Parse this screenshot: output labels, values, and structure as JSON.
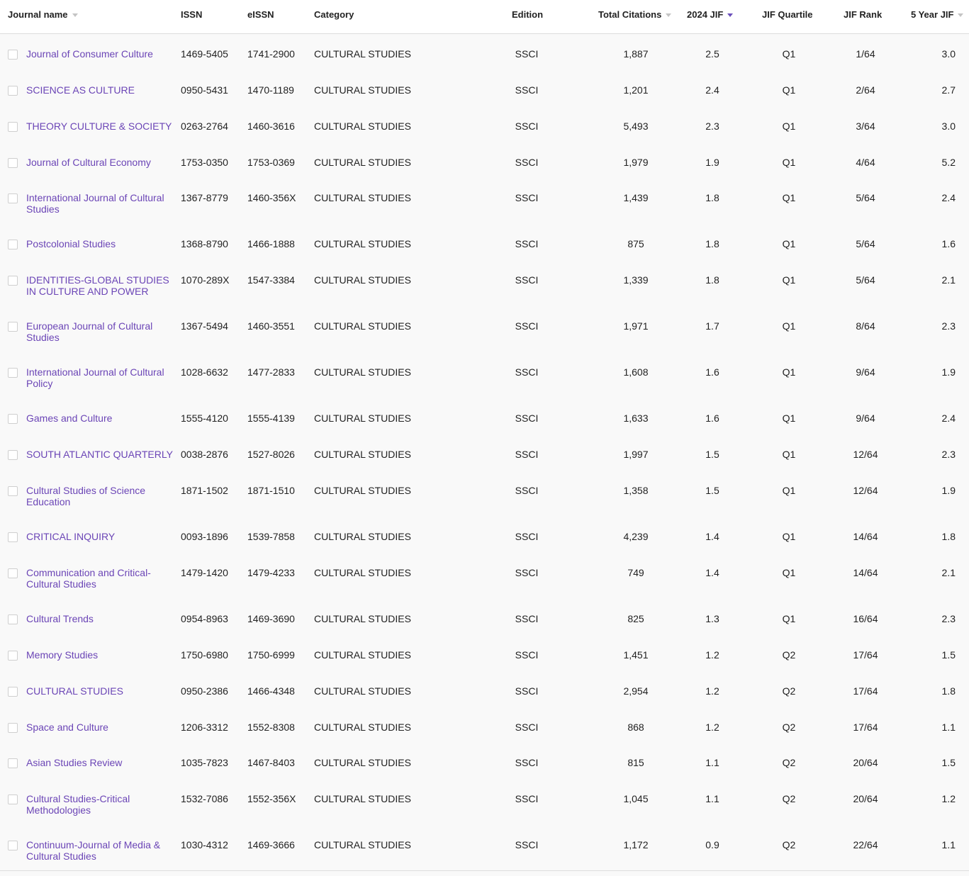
{
  "columns": {
    "journal_name": "Journal name",
    "issn": "ISSN",
    "eissn": "eISSN",
    "category": "Category",
    "edition": "Edition",
    "total_citations": "Total Citations",
    "jif": "2024 JIF",
    "quartile": "JIF Quartile",
    "rank": "JIF Rank",
    "five_year_jif": "5 Year JIF"
  },
  "rows": [
    {
      "name": "Journal of Consumer Culture",
      "issn": "1469-5405",
      "eissn": "1741-2900",
      "category": "CULTURAL STUDIES",
      "edition": "SSCI",
      "citations": "1,887",
      "jif": "2.5",
      "quartile": "Q1",
      "rank": "1/64",
      "five": "3.0"
    },
    {
      "name": "SCIENCE AS CULTURE",
      "issn": "0950-5431",
      "eissn": "1470-1189",
      "category": "CULTURAL STUDIES",
      "edition": "SSCI",
      "citations": "1,201",
      "jif": "2.4",
      "quartile": "Q1",
      "rank": "2/64",
      "five": "2.7"
    },
    {
      "name": "THEORY CULTURE & SOCIETY",
      "issn": "0263-2764",
      "eissn": "1460-3616",
      "category": "CULTURAL STUDIES",
      "edition": "SSCI",
      "citations": "5,493",
      "jif": "2.3",
      "quartile": "Q1",
      "rank": "3/64",
      "five": "3.0"
    },
    {
      "name": "Journal of Cultural Economy",
      "issn": "1753-0350",
      "eissn": "1753-0369",
      "category": "CULTURAL STUDIES",
      "edition": "SSCI",
      "citations": "1,979",
      "jif": "1.9",
      "quartile": "Q1",
      "rank": "4/64",
      "five": "5.2"
    },
    {
      "name": "International Journal of Cultural Studies",
      "issn": "1367-8779",
      "eissn": "1460-356X",
      "category": "CULTURAL STUDIES",
      "edition": "SSCI",
      "citations": "1,439",
      "jif": "1.8",
      "quartile": "Q1",
      "rank": "5/64",
      "five": "2.4"
    },
    {
      "name": "Postcolonial Studies",
      "issn": "1368-8790",
      "eissn": "1466-1888",
      "category": "CULTURAL STUDIES",
      "edition": "SSCI",
      "citations": "875",
      "jif": "1.8",
      "quartile": "Q1",
      "rank": "5/64",
      "five": "1.6"
    },
    {
      "name": "IDENTITIES-GLOBAL STUDIES IN CULTURE AND POWER",
      "issn": "1070-289X",
      "eissn": "1547-3384",
      "category": "CULTURAL STUDIES",
      "edition": "SSCI",
      "citations": "1,339",
      "jif": "1.8",
      "quartile": "Q1",
      "rank": "5/64",
      "five": "2.1"
    },
    {
      "name": "European Journal of Cultural Studies",
      "issn": "1367-5494",
      "eissn": "1460-3551",
      "category": "CULTURAL STUDIES",
      "edition": "SSCI",
      "citations": "1,971",
      "jif": "1.7",
      "quartile": "Q1",
      "rank": "8/64",
      "five": "2.3"
    },
    {
      "name": "International Journal of Cultural Policy",
      "issn": "1028-6632",
      "eissn": "1477-2833",
      "category": "CULTURAL STUDIES",
      "edition": "SSCI",
      "citations": "1,608",
      "jif": "1.6",
      "quartile": "Q1",
      "rank": "9/64",
      "five": "1.9"
    },
    {
      "name": "Games and Culture",
      "issn": "1555-4120",
      "eissn": "1555-4139",
      "category": "CULTURAL STUDIES",
      "edition": "SSCI",
      "citations": "1,633",
      "jif": "1.6",
      "quartile": "Q1",
      "rank": "9/64",
      "five": "2.4"
    },
    {
      "name": "SOUTH ATLANTIC QUARTERLY",
      "issn": "0038-2876",
      "eissn": "1527-8026",
      "category": "CULTURAL STUDIES",
      "edition": "SSCI",
      "citations": "1,997",
      "jif": "1.5",
      "quartile": "Q1",
      "rank": "12/64",
      "five": "2.3"
    },
    {
      "name": "Cultural Studies of Science Education",
      "issn": "1871-1502",
      "eissn": "1871-1510",
      "category": "CULTURAL STUDIES",
      "edition": "SSCI",
      "citations": "1,358",
      "jif": "1.5",
      "quartile": "Q1",
      "rank": "12/64",
      "five": "1.9"
    },
    {
      "name": "CRITICAL INQUIRY",
      "issn": "0093-1896",
      "eissn": "1539-7858",
      "category": "CULTURAL STUDIES",
      "edition": "SSCI",
      "citations": "4,239",
      "jif": "1.4",
      "quartile": "Q1",
      "rank": "14/64",
      "five": "1.8"
    },
    {
      "name": "Communication and Critical-Cultural Studies",
      "issn": "1479-1420",
      "eissn": "1479-4233",
      "category": "CULTURAL STUDIES",
      "edition": "SSCI",
      "citations": "749",
      "jif": "1.4",
      "quartile": "Q1",
      "rank": "14/64",
      "five": "2.1"
    },
    {
      "name": "Cultural Trends",
      "issn": "0954-8963",
      "eissn": "1469-3690",
      "category": "CULTURAL STUDIES",
      "edition": "SSCI",
      "citations": "825",
      "jif": "1.3",
      "quartile": "Q1",
      "rank": "16/64",
      "five": "2.3"
    },
    {
      "name": "Memory Studies",
      "issn": "1750-6980",
      "eissn": "1750-6999",
      "category": "CULTURAL STUDIES",
      "edition": "SSCI",
      "citations": "1,451",
      "jif": "1.2",
      "quartile": "Q2",
      "rank": "17/64",
      "five": "1.5"
    },
    {
      "name": "CULTURAL STUDIES",
      "issn": "0950-2386",
      "eissn": "1466-4348",
      "category": "CULTURAL STUDIES",
      "edition": "SSCI",
      "citations": "2,954",
      "jif": "1.2",
      "quartile": "Q2",
      "rank": "17/64",
      "five": "1.8"
    },
    {
      "name": "Space and Culture",
      "issn": "1206-3312",
      "eissn": "1552-8308",
      "category": "CULTURAL STUDIES",
      "edition": "SSCI",
      "citations": "868",
      "jif": "1.2",
      "quartile": "Q2",
      "rank": "17/64",
      "five": "1.1"
    },
    {
      "name": "Asian Studies Review",
      "issn": "1035-7823",
      "eissn": "1467-8403",
      "category": "CULTURAL STUDIES",
      "edition": "SSCI",
      "citations": "815",
      "jif": "1.1",
      "quartile": "Q2",
      "rank": "20/64",
      "five": "1.5"
    },
    {
      "name": "Cultural Studies-Critical Methodologies",
      "issn": "1532-7086",
      "eissn": "1552-356X",
      "category": "CULTURAL STUDIES",
      "edition": "SSCI",
      "citations": "1,045",
      "jif": "1.1",
      "quartile": "Q2",
      "rank": "20/64",
      "five": "1.2"
    },
    {
      "name": "Continuum-Journal of Media & Cultural Studies",
      "issn": "1030-4312",
      "eissn": "1469-3666",
      "category": "CULTURAL STUDIES",
      "edition": "SSCI",
      "citations": "1,172",
      "jif": "0.9",
      "quartile": "Q2",
      "rank": "22/64",
      "five": "1.1"
    }
  ]
}
